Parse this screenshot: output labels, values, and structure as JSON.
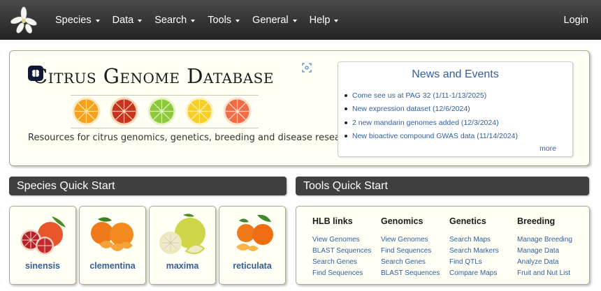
{
  "nav": {
    "items": [
      {
        "label": "Species"
      },
      {
        "label": "Data"
      },
      {
        "label": "Search"
      },
      {
        "label": "Tools"
      },
      {
        "label": "General"
      },
      {
        "label": "Help"
      }
    ],
    "login": "Login"
  },
  "hero": {
    "title": "Citrus Genome Database",
    "subtitle": "Resources for citrus genomics, genetics, breeding and disease research",
    "fruit_colors": [
      "#f5a11b",
      "#c8331f",
      "#8bc93a",
      "#f6cf24",
      "#f06c45"
    ]
  },
  "news": {
    "title": "News and Events",
    "items": [
      "Come see us at PAG 32 (1/11-1/13/2025)",
      "New expression dataset (12/6/2024)",
      "2 new mandarin genomes added (12/3/2024)",
      "New bioactive compound GWAS data (11/14/2024)"
    ],
    "more": "more"
  },
  "species_section": {
    "title": "Species Quick Start",
    "species": [
      {
        "label": "sinensis"
      },
      {
        "label": "clementina"
      },
      {
        "label": "maxima"
      },
      {
        "label": "reticulata"
      }
    ]
  },
  "tools_section": {
    "title": "Tools Quick Start",
    "columns": [
      {
        "head": "HLB links",
        "links": [
          "View Genomes",
          "BLAST Sequences",
          "Search Genes",
          "Find Sequences"
        ]
      },
      {
        "head": "Genomics",
        "links": [
          "View Genomes",
          "Find Sequences",
          "Search Genes",
          "BLAST Sequences"
        ]
      },
      {
        "head": "Genetics",
        "links": [
          "Search Maps",
          "Search Markers",
          "Find QTLs",
          "Compare Maps"
        ]
      },
      {
        "head": "Breeding",
        "links": [
          "Manage Breeding",
          "Manage Data",
          "Analyze Data",
          "Fruit and Nut List"
        ]
      }
    ]
  },
  "colors": {
    "navbar": "#2b2b2b",
    "link": "#335e9a",
    "panel_bg": "#fffff6",
    "section_header": "#404040"
  }
}
